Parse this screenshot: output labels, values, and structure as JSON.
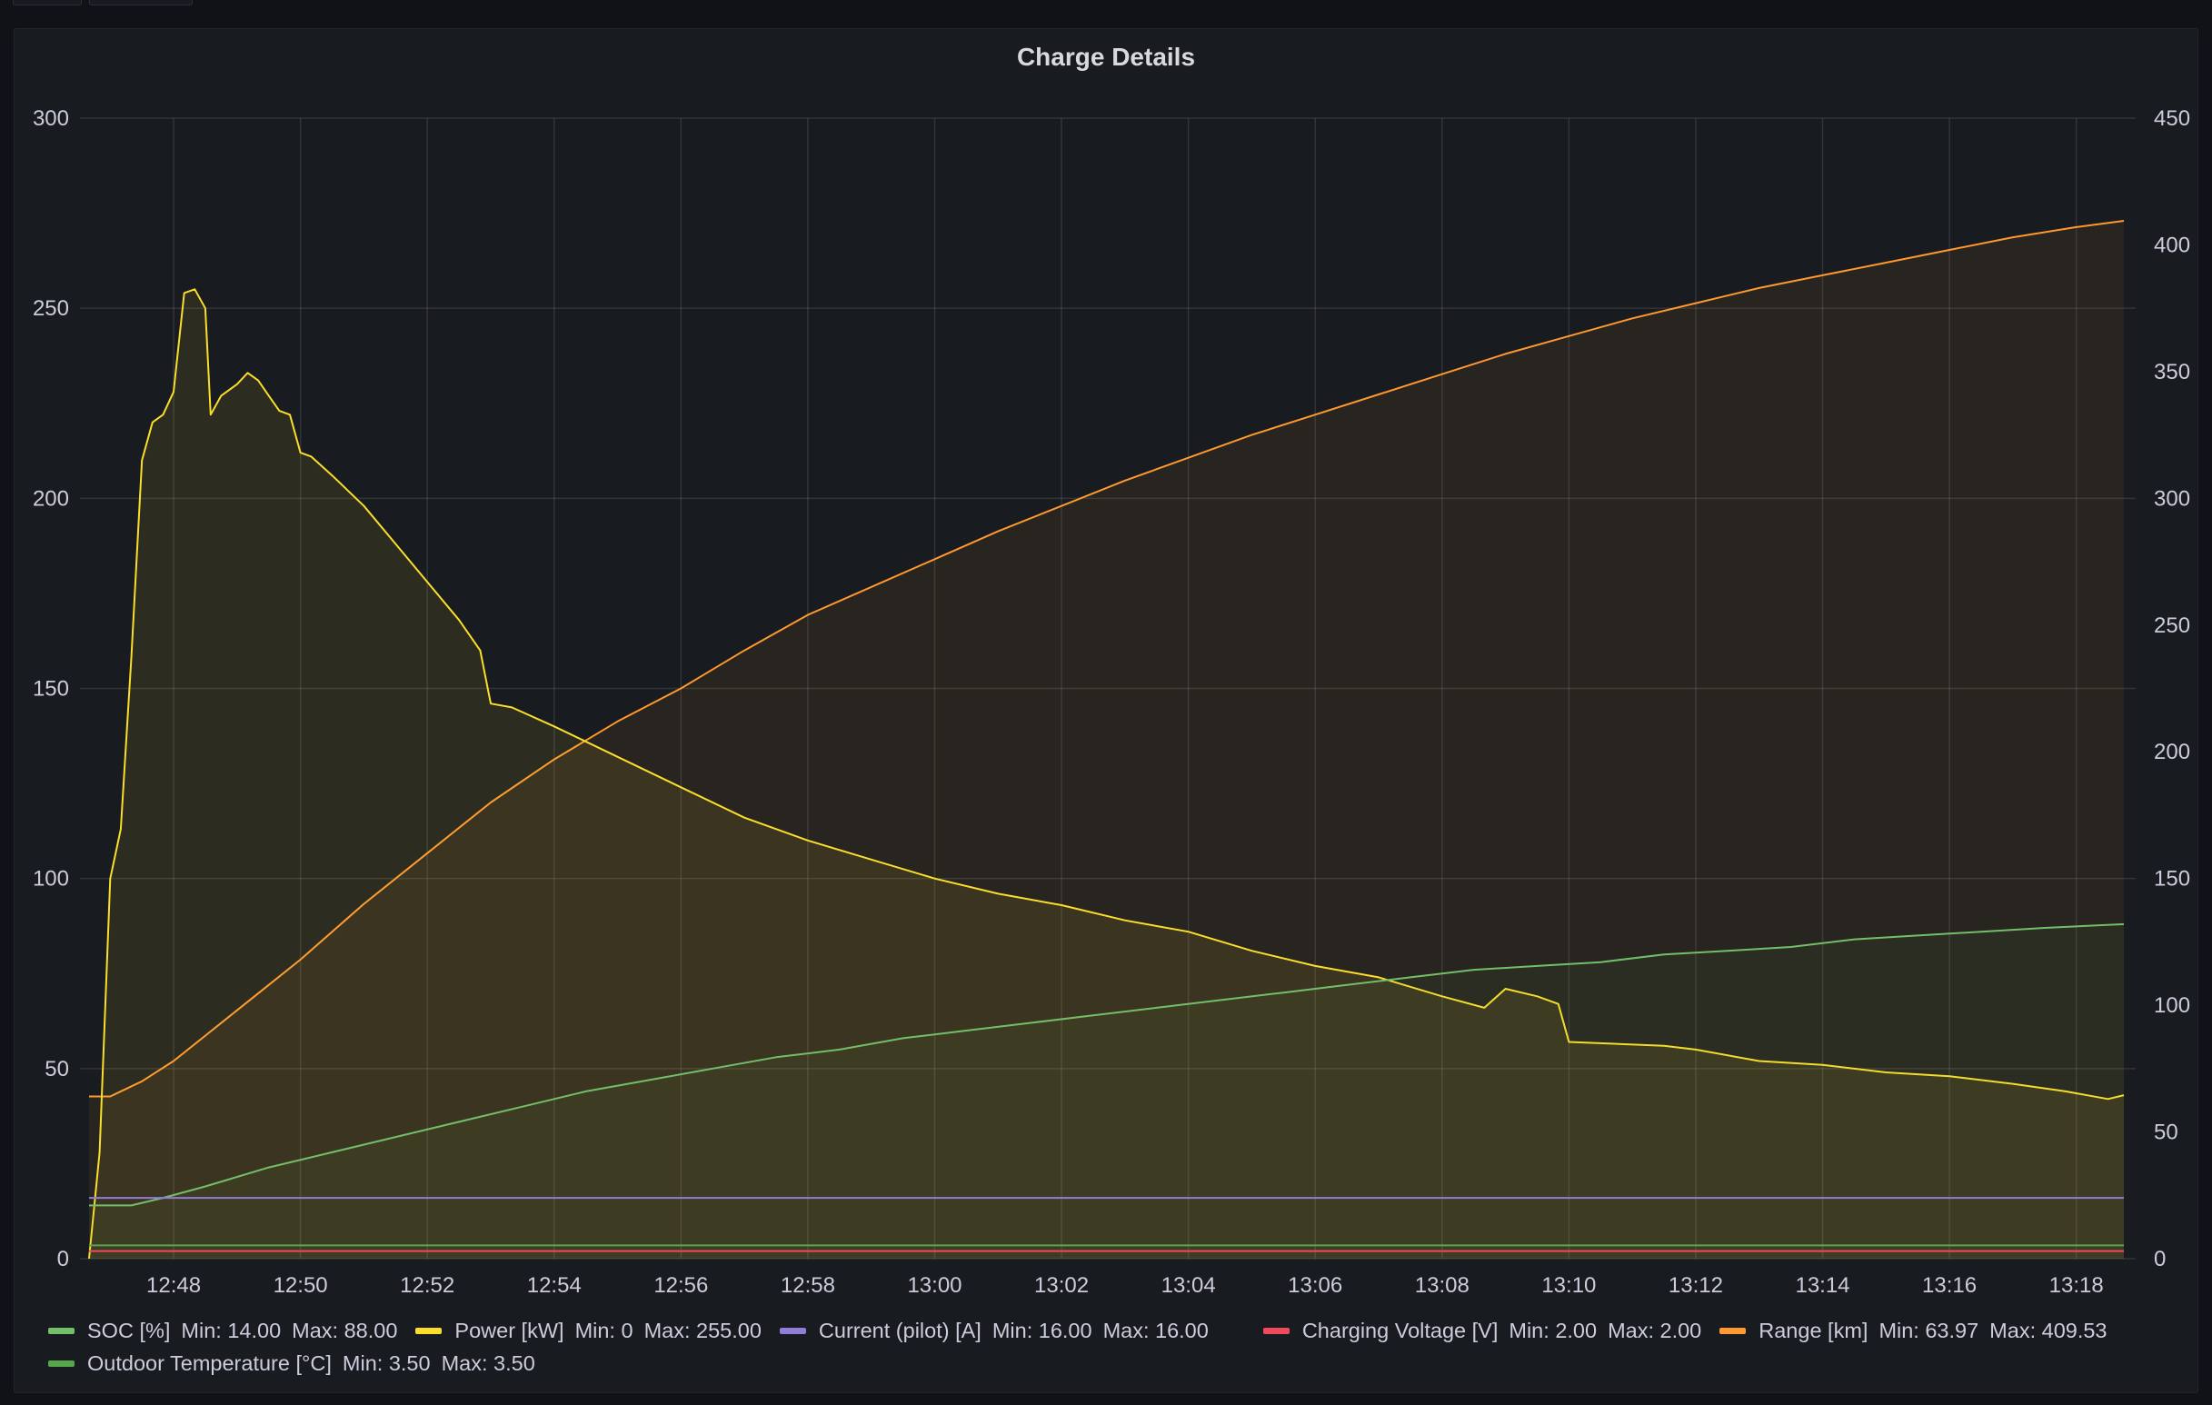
{
  "panel": {
    "title": "Charge Details"
  },
  "chart_data": {
    "type": "line",
    "title": "Charge Details",
    "x_ticks": [
      "12:48",
      "12:50",
      "12:52",
      "12:54",
      "12:56",
      "12:58",
      "13:00",
      "13:02",
      "13:04",
      "13:06",
      "13:08",
      "13:10",
      "13:12",
      "13:14",
      "13:16",
      "13:18"
    ],
    "x_range": [
      "12:46:40",
      "13:18:45"
    ],
    "y_left": {
      "ylim": [
        0,
        300
      ],
      "ticks": [
        "0",
        "50",
        "100",
        "150",
        "200",
        "250",
        "300"
      ]
    },
    "y_right": {
      "ylim": [
        0,
        450
      ],
      "ticks": [
        "0",
        "50",
        "100",
        "150",
        "200",
        "250",
        "300",
        "350",
        "400",
        "450"
      ]
    },
    "grid": true,
    "legend_position": "bottom",
    "series": [
      {
        "name": "SOC [%]",
        "color": "#73bf69",
        "axis": "left",
        "min_label": "Min: 14.00",
        "max_label": "Max: 88.00",
        "points": [
          [
            "12:46:40",
            14
          ],
          [
            "12:47:20",
            14
          ],
          [
            "12:47:50",
            16
          ],
          [
            "12:48:30",
            19
          ],
          [
            "12:49:30",
            24
          ],
          [
            "12:50:30",
            28
          ],
          [
            "12:51:30",
            32
          ],
          [
            "12:52:30",
            36
          ],
          [
            "12:53:30",
            40
          ],
          [
            "12:54:30",
            44
          ],
          [
            "12:55:30",
            47
          ],
          [
            "12:56:30",
            50
          ],
          [
            "12:57:30",
            53
          ],
          [
            "12:58:30",
            55
          ],
          [
            "12:59:30",
            58
          ],
          [
            "13:00:30",
            60
          ],
          [
            "13:01:30",
            62
          ],
          [
            "13:02:30",
            64
          ],
          [
            "13:03:30",
            66
          ],
          [
            "13:04:30",
            68
          ],
          [
            "13:05:30",
            70
          ],
          [
            "13:06:30",
            72
          ],
          [
            "13:07:30",
            74
          ],
          [
            "13:08:30",
            76
          ],
          [
            "13:09:30",
            77
          ],
          [
            "13:10:30",
            78
          ],
          [
            "13:11:30",
            80
          ],
          [
            "13:12:30",
            81
          ],
          [
            "13:13:30",
            82
          ],
          [
            "13:14:30",
            84
          ],
          [
            "13:15:30",
            85
          ],
          [
            "13:16:30",
            86
          ],
          [
            "13:17:30",
            87
          ],
          [
            "13:18:45",
            88
          ]
        ]
      },
      {
        "name": "Power [kW]",
        "color": "#fade2a",
        "axis": "left",
        "min_label": "Min: 0",
        "max_label": "Max: 255.00",
        "points": [
          [
            "12:46:40",
            0
          ],
          [
            "12:46:50",
            28
          ],
          [
            "12:47:00",
            100
          ],
          [
            "12:47:10",
            113
          ],
          [
            "12:47:20",
            158
          ],
          [
            "12:47:30",
            210
          ],
          [
            "12:47:40",
            220
          ],
          [
            "12:47:50",
            222
          ],
          [
            "12:48:00",
            228
          ],
          [
            "12:48:10",
            254
          ],
          [
            "12:48:20",
            255
          ],
          [
            "12:48:30",
            250
          ],
          [
            "12:48:35",
            222
          ],
          [
            "12:48:45",
            227
          ],
          [
            "12:49:00",
            230
          ],
          [
            "12:49:10",
            233
          ],
          [
            "12:49:20",
            231
          ],
          [
            "12:49:30",
            227
          ],
          [
            "12:49:40",
            223
          ],
          [
            "12:49:50",
            222
          ],
          [
            "12:50:00",
            212
          ],
          [
            "12:50:10",
            211
          ],
          [
            "12:50:30",
            206
          ],
          [
            "12:51:00",
            198
          ],
          [
            "12:51:30",
            188
          ],
          [
            "12:52:00",
            178
          ],
          [
            "12:52:30",
            168
          ],
          [
            "12:52:50",
            160
          ],
          [
            "12:53:00",
            146
          ],
          [
            "12:53:20",
            145
          ],
          [
            "12:54:00",
            140
          ],
          [
            "12:55:00",
            132
          ],
          [
            "12:56:00",
            124
          ],
          [
            "12:57:00",
            116
          ],
          [
            "12:58:00",
            110
          ],
          [
            "12:59:00",
            105
          ],
          [
            "13:00:00",
            100
          ],
          [
            "13:01:00",
            96
          ],
          [
            "13:02:00",
            93
          ],
          [
            "13:03:00",
            89
          ],
          [
            "13:04:00",
            86
          ],
          [
            "13:05:00",
            81
          ],
          [
            "13:06:00",
            77
          ],
          [
            "13:07:00",
            74
          ],
          [
            "13:08:00",
            69
          ],
          [
            "13:08:40",
            66
          ],
          [
            "13:09:00",
            71
          ],
          [
            "13:09:30",
            69
          ],
          [
            "13:09:50",
            67
          ],
          [
            "13:10:00",
            57
          ],
          [
            "13:11:30",
            56
          ],
          [
            "13:12:00",
            55
          ],
          [
            "13:13:00",
            52
          ],
          [
            "13:14:00",
            51
          ],
          [
            "13:15:00",
            49
          ],
          [
            "13:16:00",
            48
          ],
          [
            "13:17:00",
            46
          ],
          [
            "13:17:50",
            44
          ],
          [
            "13:18:30",
            42
          ],
          [
            "13:18:45",
            43
          ]
        ]
      },
      {
        "name": "Current (pilot) [A]",
        "color": "#8f7dd8",
        "axis": "left",
        "min_label": "Min: 16.00",
        "max_label": "Max: 16.00",
        "points": [
          [
            "12:46:40",
            16
          ],
          [
            "13:18:45",
            16
          ]
        ]
      },
      {
        "name": "Charging Voltage [V]",
        "color": "#f2495c",
        "axis": "left",
        "min_label": "Min: 2.00",
        "max_label": "Max: 2.00",
        "points": [
          [
            "12:46:40",
            2
          ],
          [
            "13:18:45",
            2
          ]
        ]
      },
      {
        "name": "Range [km]",
        "color": "#ff9830",
        "axis": "right",
        "min_label": "Min: 63.97",
        "max_label": "Max: 409.53",
        "points": [
          [
            "12:46:40",
            64
          ],
          [
            "12:47:00",
            64
          ],
          [
            "12:47:30",
            70
          ],
          [
            "12:48:00",
            78
          ],
          [
            "12:48:30",
            88
          ],
          [
            "12:49:00",
            98
          ],
          [
            "12:49:30",
            108
          ],
          [
            "12:50:00",
            118
          ],
          [
            "12:51:00",
            140
          ],
          [
            "12:52:00",
            160
          ],
          [
            "12:53:00",
            180
          ],
          [
            "12:54:00",
            197
          ],
          [
            "12:55:00",
            212
          ],
          [
            "12:56:00",
            225
          ],
          [
            "12:57:00",
            240
          ],
          [
            "12:58:00",
            254
          ],
          [
            "12:59:00",
            265
          ],
          [
            "13:00:00",
            276
          ],
          [
            "13:01:00",
            287
          ],
          [
            "13:02:00",
            297
          ],
          [
            "13:03:00",
            307
          ],
          [
            "13:04:00",
            316
          ],
          [
            "13:05:00",
            325
          ],
          [
            "13:06:00",
            333
          ],
          [
            "13:07:00",
            341
          ],
          [
            "13:08:00",
            349
          ],
          [
            "13:09:00",
            357
          ],
          [
            "13:10:00",
            364
          ],
          [
            "13:11:00",
            371
          ],
          [
            "13:12:00",
            377
          ],
          [
            "13:13:00",
            383
          ],
          [
            "13:14:00",
            388
          ],
          [
            "13:15:00",
            393
          ],
          [
            "13:16:00",
            398
          ],
          [
            "13:17:00",
            403
          ],
          [
            "13:18:00",
            407
          ],
          [
            "13:18:45",
            409.5
          ]
        ]
      },
      {
        "name": "Outdoor Temperature [°C]",
        "color": "#56a64b",
        "axis": "left",
        "min_label": "Min: 3.50",
        "max_label": "Max: 3.50",
        "points": [
          [
            "12:46:40",
            3.5
          ],
          [
            "13:18:45",
            3.5
          ]
        ]
      }
    ]
  }
}
